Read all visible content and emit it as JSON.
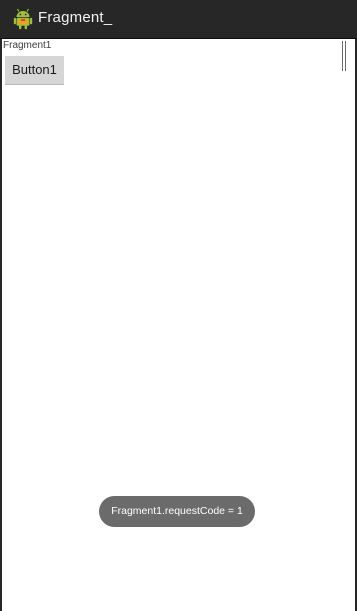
{
  "action_bar": {
    "title": "Fragment_",
    "icon": "android-robot-icon"
  },
  "fragment": {
    "label": "Fragment1",
    "button_label": "Button1"
  },
  "toast": {
    "message": "Fragment1.requestCode = 1"
  },
  "colors": {
    "action_bar_bg": "#272727",
    "content_bg": "#ffffff",
    "button_bg": "#d6d6d6",
    "toast_bg": "#6b6b6b",
    "android_green": "#9fbf3b"
  }
}
